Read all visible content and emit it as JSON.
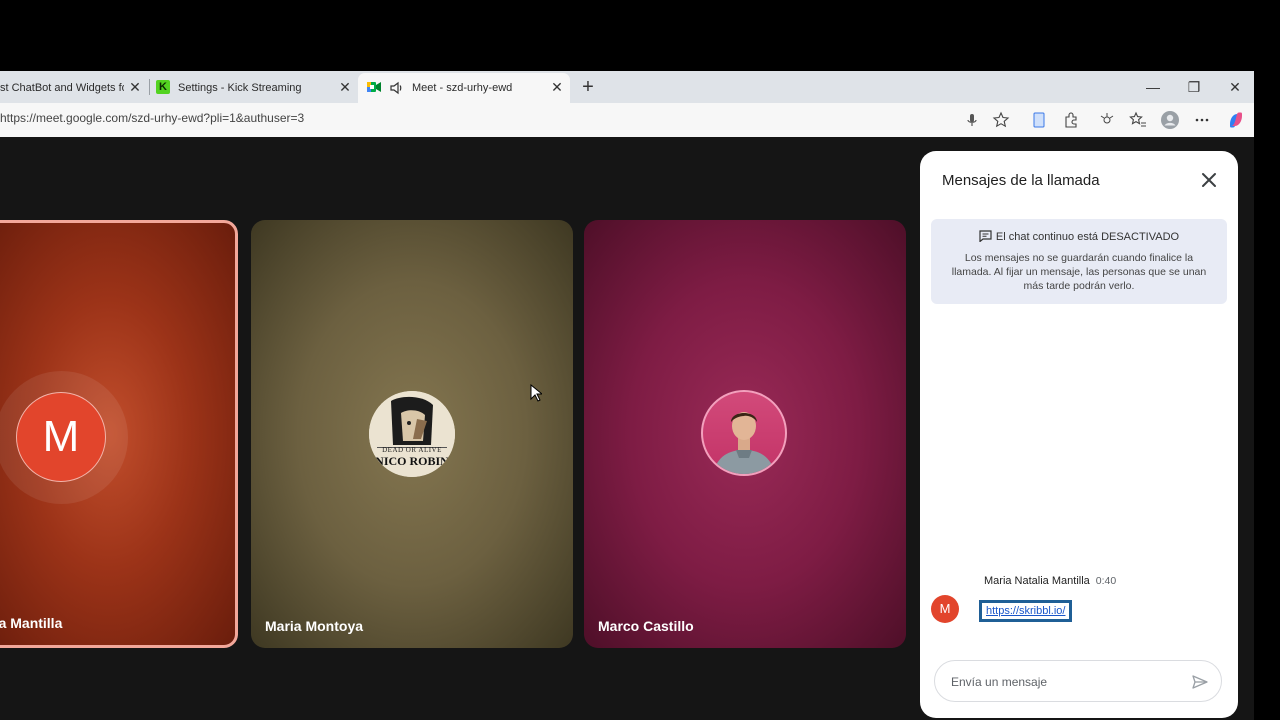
{
  "browser": {
    "tabs": [
      {
        "title": "st ChatBot and Widgets for",
        "close": "✕"
      },
      {
        "title": "Settings - Kick Streaming",
        "close": "✕",
        "icon_letter": "K"
      },
      {
        "title": "Meet - szd-urhy-ewd",
        "close": "✕"
      }
    ],
    "new_tab": "+",
    "window_controls": {
      "minimize": "—",
      "maximize": "❐",
      "close": "✕"
    },
    "url": "https://meet.google.com/szd-urhy-ewd?pli=1&authuser=3"
  },
  "meeting": {
    "participants": [
      {
        "name": "alia Mantilla",
        "initial": "M"
      },
      {
        "name": "Maria Montoya",
        "avatar_caption_1": "DEAD OR ALIVE",
        "avatar_caption_2": "NICO ROBIN"
      },
      {
        "name": "Marco Castillo"
      }
    ]
  },
  "chat_panel": {
    "title": "Mensajes de la llamada",
    "info_heading": "El chat continuo está DESACTIVADO",
    "info_body": "Los mensajes no se guardarán cuando finalice la llamada. Al fijar un mensaje, las personas que se unan más tarde podrán verlo.",
    "message": {
      "sender": "Maria Natalia Mantilla",
      "time": "0:40",
      "avatar_initial": "M",
      "link": "https://skribbl.io/"
    },
    "compose_placeholder": "Envía un mensaje"
  },
  "colors": {
    "accent_red": "#e2452c",
    "link_blue": "#1a56c9",
    "focus_border": "#1f5f96"
  }
}
